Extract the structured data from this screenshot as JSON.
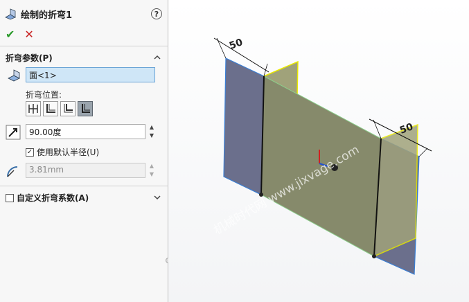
{
  "header": {
    "title": "绘制的折弯1",
    "help": "?"
  },
  "actions": {
    "ok": "✔",
    "cancel": "✕"
  },
  "bend_params": {
    "title": "折弯参数(P)",
    "face_value": "面<1>",
    "position_label": "折弯位置:",
    "angle_value": "90.00度",
    "use_default_radius_label": "使用默认半径(U)",
    "use_default_radius_checked": true,
    "radius_value": "3.81mm"
  },
  "custom_bend": {
    "title": "自定义折弯系数(A)",
    "checked": false
  },
  "viewport": {
    "dimension_left": "50",
    "dimension_right": "50",
    "watermark": "机械时代网 www.jixvage.com"
  },
  "colors": {
    "face": "#6b6f8c",
    "bend_face": "#8b8f6c",
    "highlight": "#e8e800",
    "accent": "#3a7fd5"
  }
}
